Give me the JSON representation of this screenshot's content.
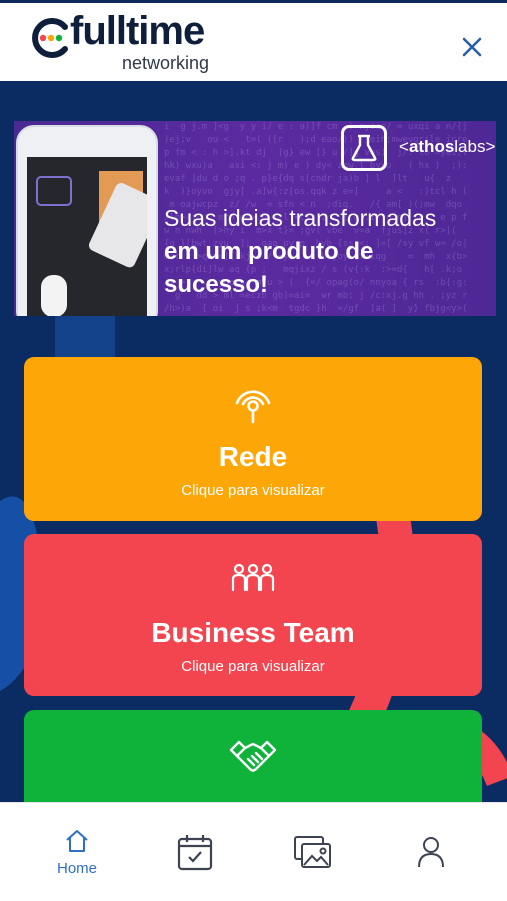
{
  "header": {
    "logo_word": "fulltime",
    "logo_sub": "networking",
    "close_icon": "close-icon"
  },
  "banner": {
    "brand_bold": "athos",
    "brand_light": "labs",
    "line1": "Suas ideias transformadas",
    "line2": "em um produto de",
    "line3": "sucesso!"
  },
  "cards": [
    {
      "icon": "signal-icon",
      "title": "Rede",
      "subtitle": "Clique para visualizar",
      "color": "#fca608"
    },
    {
      "icon": "team-icon",
      "title": "Business Team",
      "subtitle": "Clique para visualizar",
      "color": "#f2454f"
    },
    {
      "icon": "handshake-icon",
      "color": "#0fb33a"
    }
  ],
  "bottom_nav": {
    "home_label": "Home",
    "items": [
      "home-icon",
      "calendar-check-icon",
      "gallery-icon",
      "profile-icon"
    ],
    "active_color": "#2f6fc4"
  },
  "colors": {
    "background": "#0b2c63",
    "banner": "#5b2aa0"
  }
}
